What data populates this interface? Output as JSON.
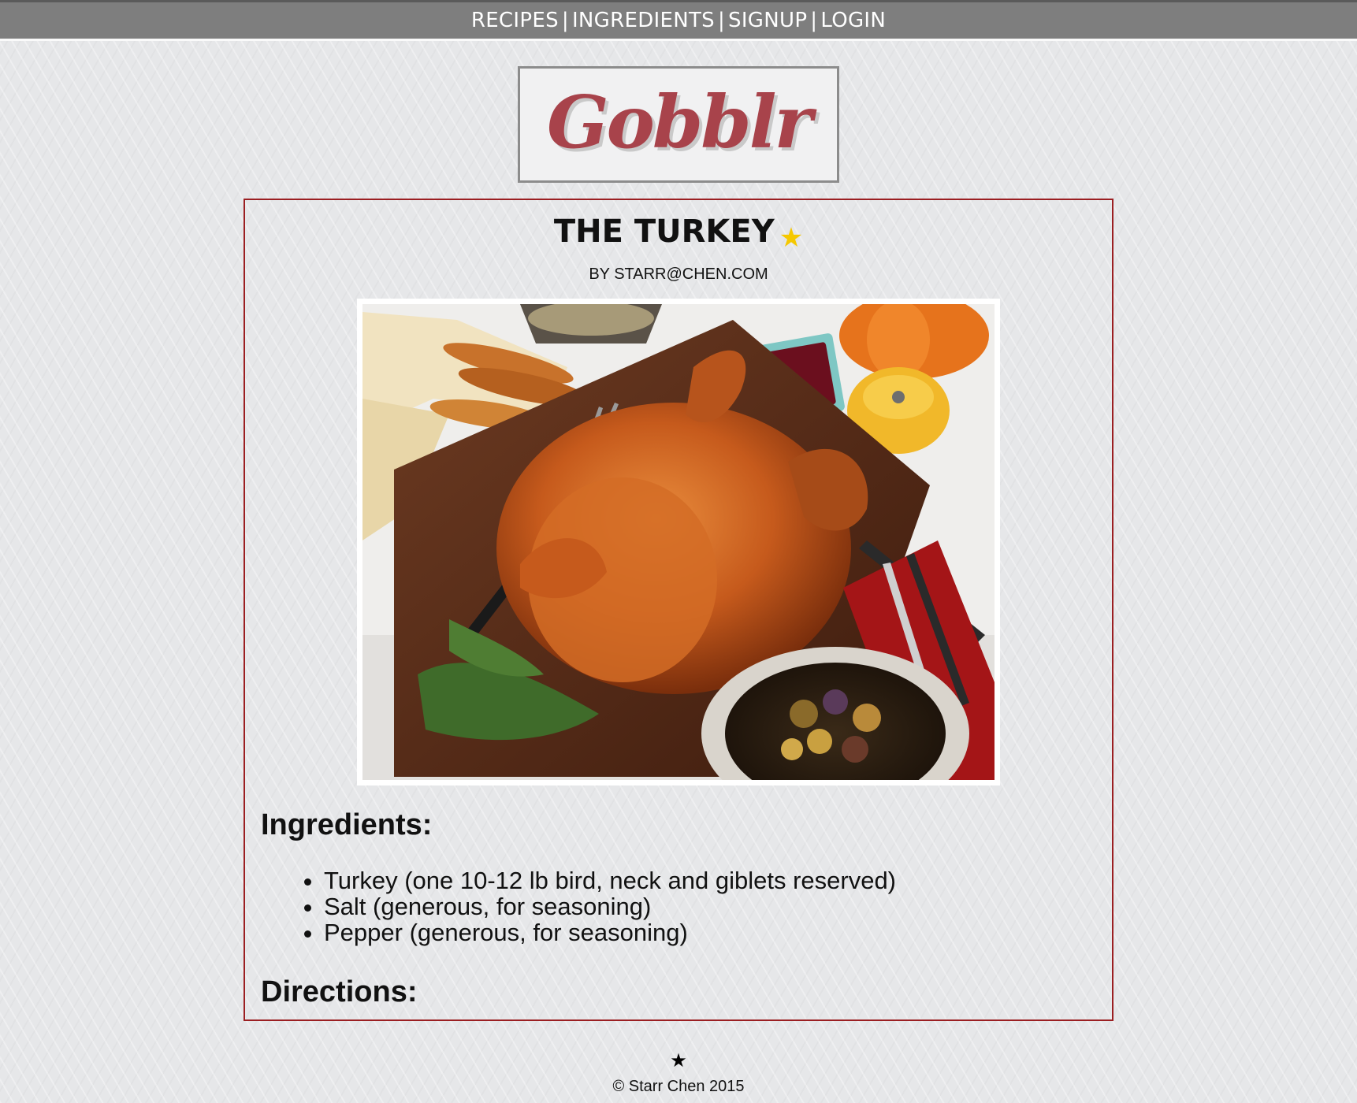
{
  "nav": {
    "items": [
      {
        "label": "RECIPES"
      },
      {
        "label": "INGREDIENTS"
      },
      {
        "label": "SIGNUP"
      },
      {
        "label": "LOGIN"
      }
    ],
    "separator": "|"
  },
  "logo": {
    "text": "Gobblr",
    "color": "#a8434b"
  },
  "recipe": {
    "title": "THE TURKEY",
    "favorite_icon": "star-icon",
    "favorite_symbol": "★",
    "favorite_color": "#f5c800",
    "author": "BY STARR@CHEN.COM",
    "photo_icon": "turkey-photo",
    "ingredients_heading": "Ingredients:",
    "ingredients": [
      "Turkey (one 10-12 lb bird, neck and giblets reserved)",
      "Salt (generous, for seasoning)",
      "Pepper (generous, for seasoning)"
    ],
    "directions_heading": "Directions:"
  },
  "footer": {
    "star_symbol": "★",
    "copyright": "© Starr Chen 2015"
  },
  "colors": {
    "nav_bg": "#7e7e7e",
    "card_border": "#9b1f22",
    "page_bg": "#e6e7e9"
  }
}
